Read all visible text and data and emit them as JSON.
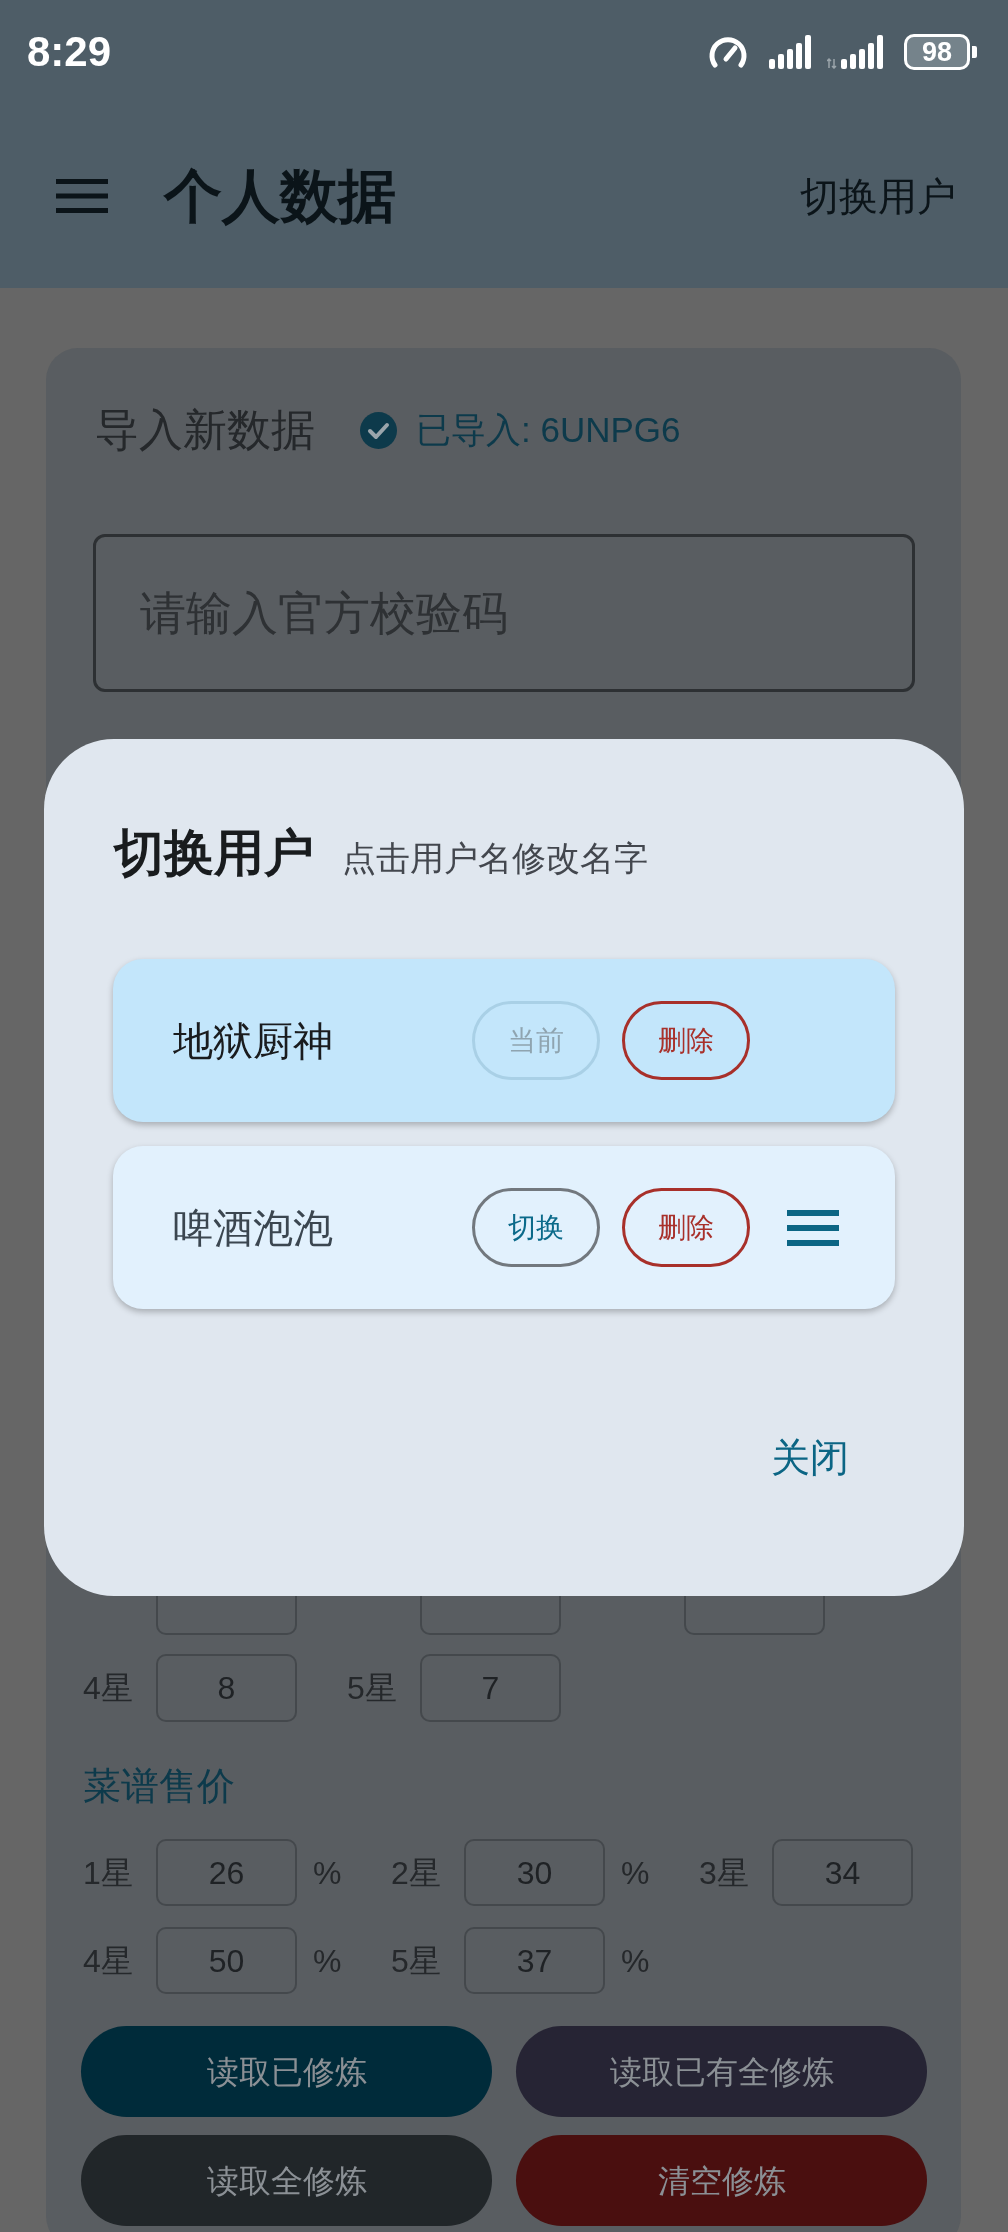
{
  "status_bar": {
    "time": "8:29",
    "battery": "98"
  },
  "app_bar": {
    "title": "个人数据",
    "action": "切换用户"
  },
  "import_card": {
    "title": "导入新数据",
    "import_status": {
      "imported": true,
      "text": "已导入: 6UNPG6"
    },
    "code_field": {
      "placeholder": "请输入官方校验码"
    },
    "star_counts": [
      {
        "kind": "covered"
      },
      {
        "kind": "covered"
      },
      {
        "kind": "covered"
      },
      {
        "kind": "field",
        "label": "4星",
        "value": "8"
      },
      {
        "kind": "field",
        "label": "5星",
        "value": "7"
      }
    ],
    "price_section": {
      "title": "菜谱售价",
      "items": [
        {
          "label": "1星",
          "value": "26",
          "unit": "%"
        },
        {
          "label": "2星",
          "value": "30",
          "unit": "%"
        },
        {
          "label": "3星",
          "value": "34"
        },
        {
          "label": "4星",
          "value": "50",
          "unit": "%"
        },
        {
          "label": "5星",
          "value": "37",
          "unit": "%"
        }
      ]
    },
    "buttons": [
      {
        "label": "读取已修炼",
        "color": "#002b3a"
      },
      {
        "label": "读取已有全修炼",
        "color": "#262434"
      },
      {
        "label": "读取全修炼",
        "color": "#212629"
      },
      {
        "label": "清空修炼",
        "color": "#4a0f0f"
      }
    ]
  },
  "dialog": {
    "title": "切换用户",
    "subtitle": "点击用户名修改名字",
    "users": [
      {
        "name": "地狱厨神",
        "selected": true,
        "action": "当前",
        "delete": "删除"
      },
      {
        "name": "啤酒泡泡",
        "selected": false,
        "action": "切换",
        "delete": "删除"
      }
    ],
    "close": "关闭"
  }
}
